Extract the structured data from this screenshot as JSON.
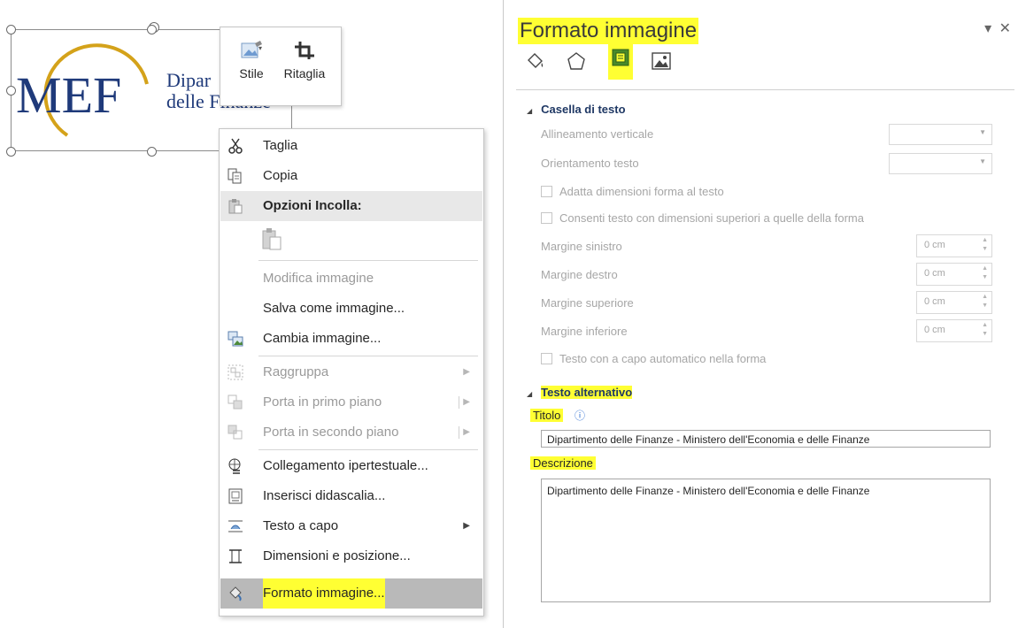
{
  "image": {
    "logo_text": "MEF",
    "caption_line1": "Dipar",
    "caption_line2": "delle Finanze",
    "brand_colors": {
      "blue": "#1f3a7a",
      "gold": "#d4a21a"
    }
  },
  "mini_toolbar": {
    "buttons": [
      {
        "label": "Stile",
        "icon": "style-icon"
      },
      {
        "label": "Ritaglia",
        "icon": "crop-icon"
      }
    ]
  },
  "context_menu": {
    "items": [
      {
        "label": "Taglia",
        "icon": "scissors-icon",
        "enabled": true
      },
      {
        "label": "Copia",
        "icon": "copy-icon",
        "enabled": true
      },
      {
        "label": "Opzioni Incolla:",
        "icon": "paste-icon",
        "header": true
      },
      {
        "label": "",
        "icon": "paste-option-icon",
        "enabled": false
      },
      {
        "label": "Modifica immagine",
        "icon": "",
        "enabled": false
      },
      {
        "label": "Salva come immagine...",
        "icon": "",
        "enabled": true
      },
      {
        "label": "Cambia immagine...",
        "icon": "change-picture-icon",
        "enabled": true
      },
      {
        "label": "Raggruppa",
        "icon": "group-icon",
        "enabled": false,
        "submenu": true
      },
      {
        "label": "Porta in primo piano",
        "icon": "bring-forward-icon",
        "enabled": false,
        "submenu": true
      },
      {
        "label": "Porta in secondo piano",
        "icon": "send-backward-icon",
        "enabled": false,
        "submenu": true
      },
      {
        "label": "Collegamento ipertestuale...",
        "icon": "hyperlink-icon",
        "enabled": true
      },
      {
        "label": "Inserisci didascalia...",
        "icon": "caption-icon",
        "enabled": true
      },
      {
        "label": "Testo a capo",
        "icon": "wrap-text-icon",
        "enabled": true,
        "submenu": true
      },
      {
        "label": "Dimensioni e posizione...",
        "icon": "size-position-icon",
        "enabled": true
      },
      {
        "label": "Formato immagine...",
        "icon": "format-picture-icon",
        "enabled": true,
        "highlighted": true
      }
    ]
  },
  "format_pane": {
    "title": "Formato immagine",
    "controls": "▾ ✕",
    "tabs": [
      {
        "name": "fill-line-tab",
        "icon": "paint-bucket-icon"
      },
      {
        "name": "effects-tab",
        "icon": "pentagon-icon"
      },
      {
        "name": "layout-properties-tab",
        "icon": "layout-properties-icon",
        "active": true
      },
      {
        "name": "picture-tab",
        "icon": "picture-icon"
      }
    ],
    "textbox_section": {
      "title": "Casella di testo",
      "vertical_alignment_label": "Allineamento verticale",
      "text_direction_label": "Orientamento testo",
      "autofit_label": "Adatta dimensioni forma al testo",
      "overflow_label": "Consenti testo con dimensioni superiori a quelle della forma",
      "margin_left_label": "Margine sinistro",
      "margin_right_label": "Margine destro",
      "margin_top_label": "Margine superiore",
      "margin_bottom_label": "Margine inferiore",
      "margin_left_value": "0 cm",
      "margin_right_value": "0 cm",
      "margin_top_value": "0 cm",
      "margin_bottom_value": "0 cm",
      "wrap_label": "Testo con a capo automatico nella forma"
    },
    "alt_text_section": {
      "title": "Testo alternativo",
      "title_label": "Titolo",
      "title_value": "Dipartimento delle Finanze - Ministero dell'Economia e delle Finanze",
      "description_label": "Descrizione",
      "description_value": "Dipartimento delle Finanze - Ministero dell'Economia e delle Finanze"
    },
    "highlight_color": "#ffff33"
  }
}
